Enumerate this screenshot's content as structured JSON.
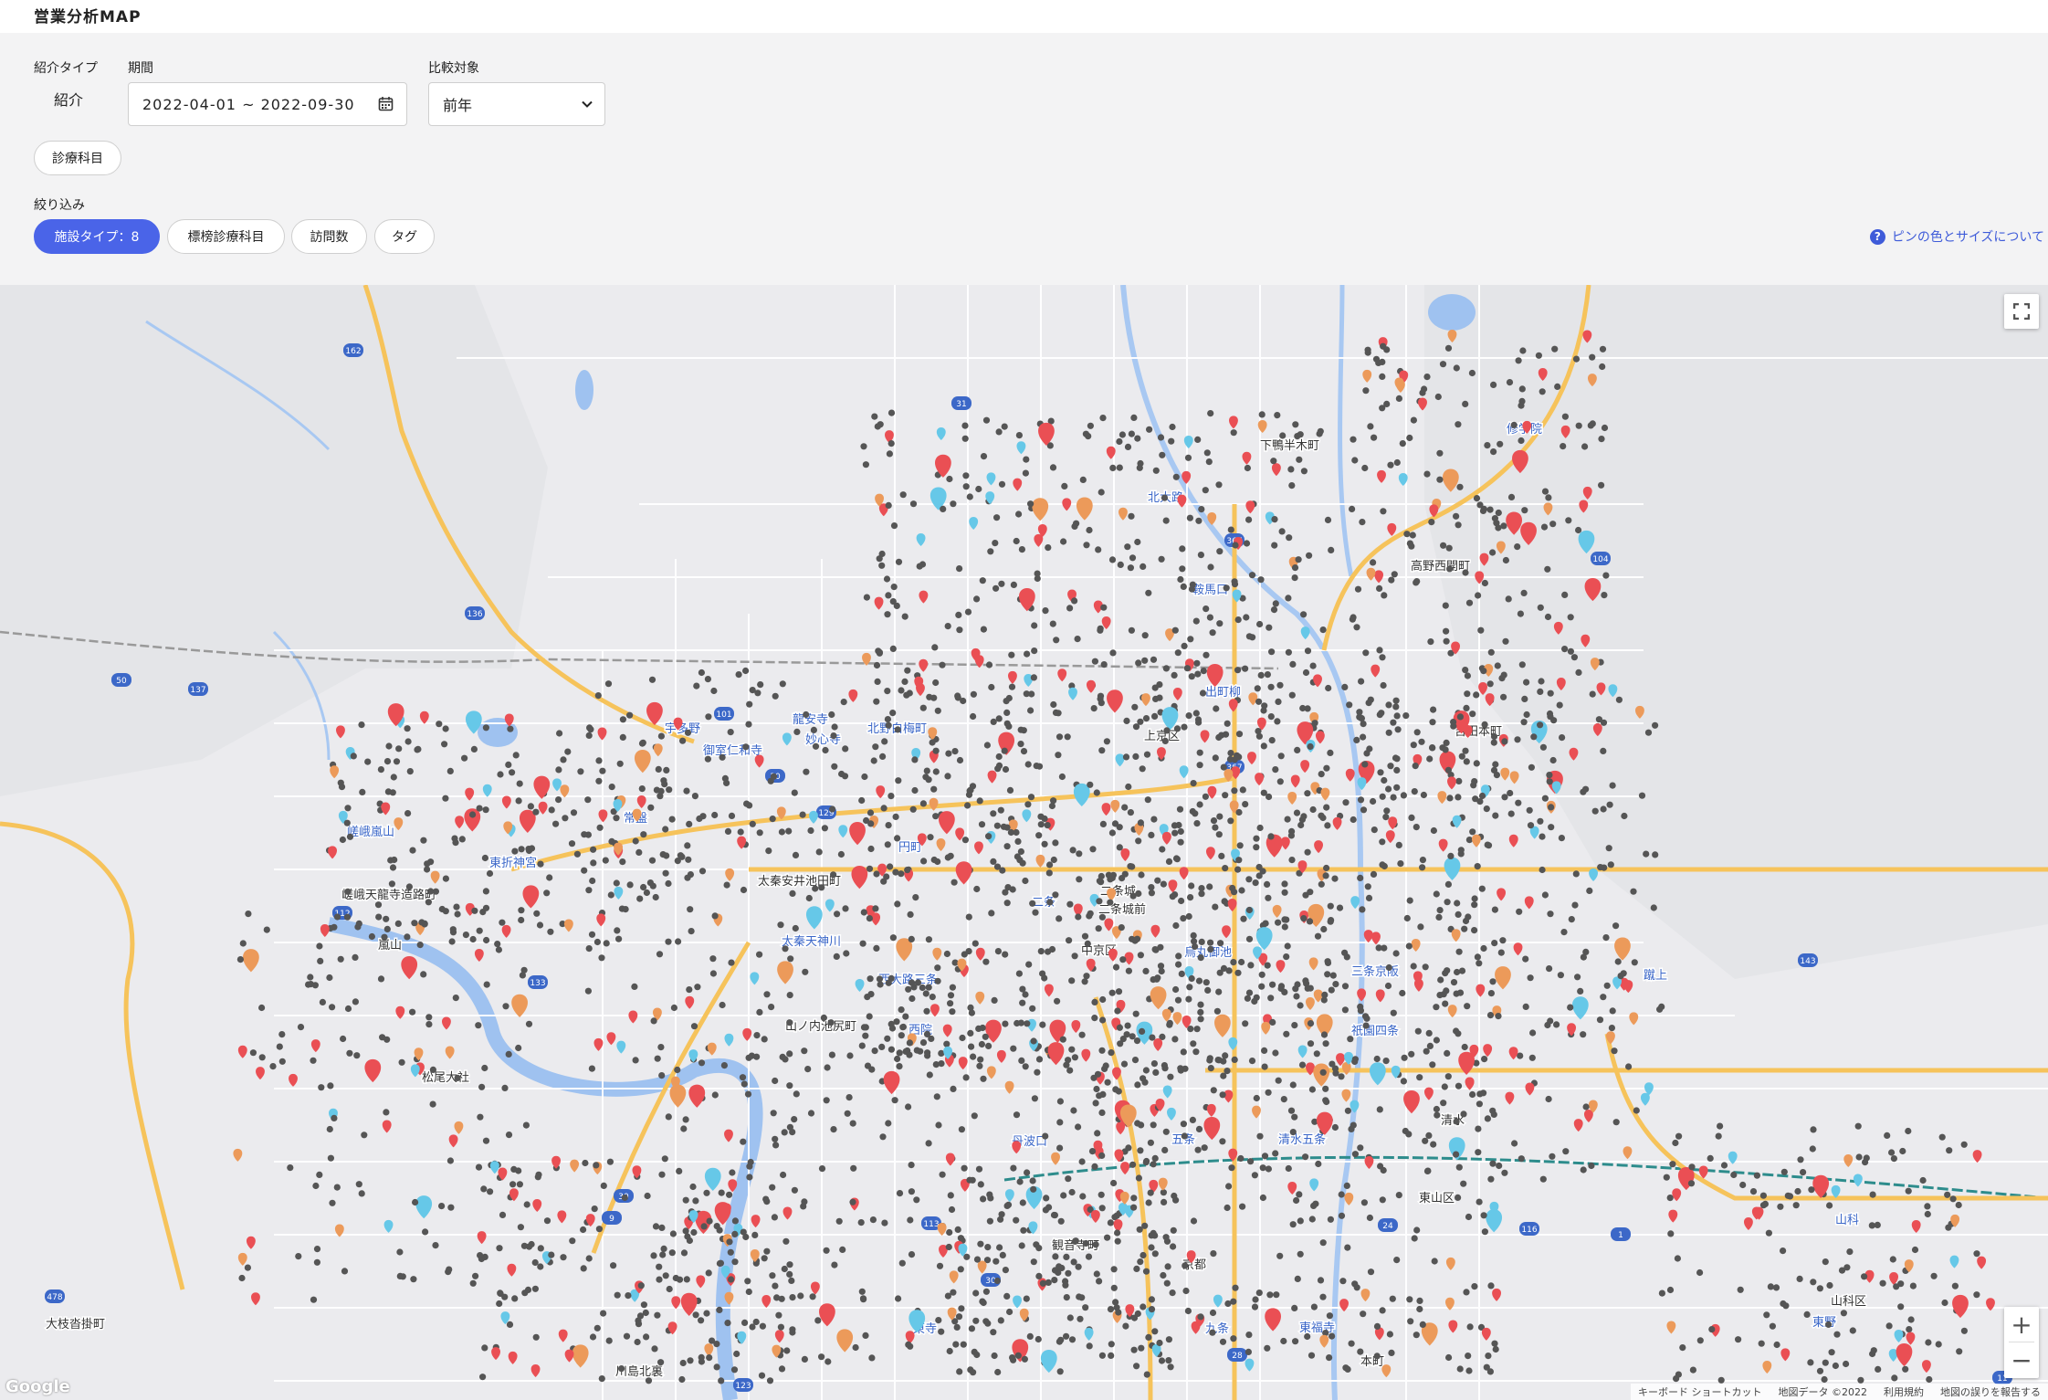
{
  "header": {
    "title": "営業分析MAP"
  },
  "filters": {
    "referral_type": {
      "label": "紹介タイプ",
      "value": "紹介"
    },
    "period": {
      "label": "期間",
      "value": "2022-04-01 ~ 2022-09-30"
    },
    "comparison": {
      "label": "比較対象",
      "value": "前年"
    },
    "department_button": "診療科目",
    "narrow_label": "絞り込み",
    "chips": [
      {
        "label": "施設タイプ：8",
        "active": true
      },
      {
        "label": "標榜診療科目",
        "active": false
      },
      {
        "label": "訪問数",
        "active": false
      },
      {
        "label": "タグ",
        "active": false
      }
    ],
    "help_link": "ピンの色とサイズについて"
  },
  "map": {
    "colors": {
      "land": "#ebebee",
      "water": "#9fc2f0",
      "road_major": "#f6c35b",
      "road_minor": "#ffffff",
      "pin_gray": "#555555",
      "pin_red": "#ea4f54",
      "pin_orange": "#ec9a5a",
      "pin_cyan": "#66c8e8"
    },
    "place_labels": [
      "上京区",
      "中京区",
      "東山区",
      "二条城前",
      "下鴨半木町",
      "高野西開町",
      "吉田本町",
      "山科区",
      "大枝沓掛町",
      "川島北裏",
      "嵐山",
      "松尾大社",
      "清水",
      "本町",
      "京都",
      "観音寺町",
      "嵯峨天龍寺造路町",
      "山ノ内池尻町",
      "太秦安井池田町",
      "二条城"
    ],
    "station_labels": [
      "嵯峨嵐山",
      "東折神宮",
      "常盤",
      "円町",
      "北野白梅町",
      "出町柳",
      "東寺",
      "九条",
      "東福寺",
      "宇多野",
      "御室仁和寺",
      "龍安寺",
      "妙心寺",
      "二条",
      "丹波口",
      "西院",
      "烏丸御池",
      "三条京阪",
      "祇園四条",
      "清水五条",
      "五条",
      "北大路",
      "鞍馬口",
      "修学院",
      "蹴上",
      "山科",
      "東野",
      "太秦天神川",
      "西大路三条"
    ],
    "route_numbers": [
      "162",
      "136",
      "50",
      "137",
      "101",
      "31",
      "367",
      "104",
      "367",
      "1",
      "143",
      "116",
      "24",
      "113",
      "9",
      "478",
      "123",
      "28",
      "11",
      "112",
      "133",
      "129",
      "30",
      "30",
      "30"
    ],
    "google_logo": "Google",
    "attribution": {
      "shortcuts": "キーボード ショートカット",
      "map_data": "地図データ ©2022",
      "terms": "利用規約",
      "report": "地図の誤りを報告する"
    }
  }
}
